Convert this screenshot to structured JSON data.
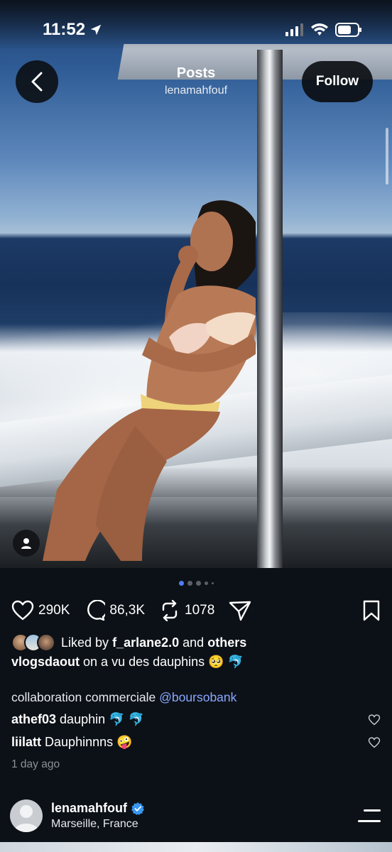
{
  "status_bar": {
    "time": "11:52",
    "icons": [
      "location-arrow-icon",
      "signal-icon",
      "wifi-icon",
      "battery-icon"
    ]
  },
  "header": {
    "title": "Posts",
    "subtitle": "lenamahfouf",
    "follow_label": "Follow",
    "back_icon": "chevron-left-icon"
  },
  "carousel": {
    "total_dots": 5,
    "active_index": 0
  },
  "actions": {
    "likes": "290K",
    "comments": "86,3K",
    "reposts": "1078",
    "icons": [
      "heart-icon",
      "comment-icon",
      "repost-icon",
      "share-icon",
      "bookmark-icon"
    ]
  },
  "liked_by": {
    "prefix": "Liked by",
    "user": "f_arlane2.0",
    "and": "and",
    "others": "others"
  },
  "caption": {
    "user": "vlogsdaout",
    "text": "on a vu des dauphins 🥺 🐬"
  },
  "collab": {
    "text": "collaboration commerciale",
    "mention": "@boursobank"
  },
  "comments": [
    {
      "user": "athef03",
      "text": "dauphin 🐬 🐬"
    },
    {
      "user": "liilatt",
      "text": "Dauphinnns 🤪"
    }
  ],
  "timestamp": "1 day ago",
  "author": {
    "name": "lenamahfouf",
    "location": "Marseille, France",
    "verified": true
  },
  "colors": {
    "accent": "#4f7cf7",
    "mention": "#8aa8ff",
    "verified": "#3897f0",
    "background": "#0c1117"
  }
}
